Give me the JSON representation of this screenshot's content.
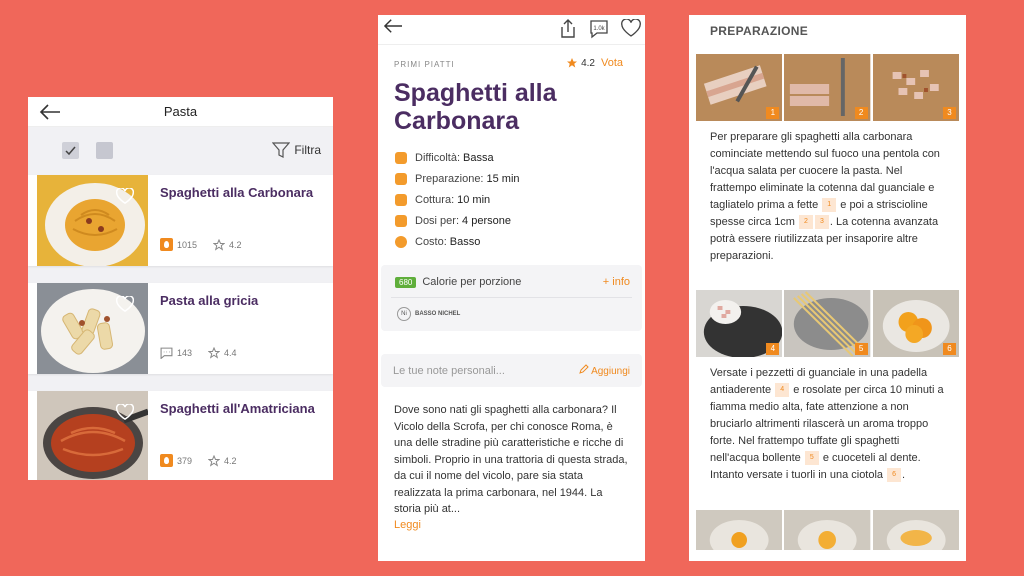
{
  "list": {
    "title": "Pasta",
    "filter_label": "Filtra",
    "recipes": [
      {
        "name": "Spaghetti alla Carbonara",
        "count": "1015",
        "rating": "4.2"
      },
      {
        "name": "Pasta alla gricia",
        "count": "143",
        "rating": "4.4"
      },
      {
        "name": "Spaghetti all'Amatriciana",
        "count": "379",
        "rating": "4.2"
      }
    ]
  },
  "detail": {
    "share_count": "1.0k",
    "category": "PRIMI PIATTI",
    "rating": "4.2",
    "vote_label": "Vota",
    "title": "Spaghetti alla Carbonara",
    "facts": [
      {
        "label": "Difficoltà:",
        "value": "Bassa"
      },
      {
        "label": "Preparazione:",
        "value": "15 min"
      },
      {
        "label": "Cottura:",
        "value": "10 min"
      },
      {
        "label": "Dosi per:",
        "value": "4 persone"
      },
      {
        "label": "Costo:",
        "value": "Basso"
      }
    ],
    "calories_value": "680",
    "calories_label": "Calorie per porzione",
    "more_info": "+ info",
    "nichel_icon_text": "Ni",
    "nichel_label": "BASSO NICHEL",
    "notes_placeholder": "Le tue note personali...",
    "notes_add": "Aggiungi",
    "intro": "Dove sono nati gli spaghetti alla carbonara? Il Vicolo della Scrofa, per chi conosce Roma, è una delle stradine più caratteristiche e ricche di simboli. Proprio in una trattoria di questa strada, da cui il nome del vicolo, pare sia stata realizzata la prima carbonara, nel 1944. La storia più at...",
    "read_more": "Leggi"
  },
  "prep": {
    "title": "PREPARAZIONE",
    "step_numbers": [
      "1",
      "2",
      "3",
      "4",
      "5",
      "6"
    ],
    "para1_a": "Per preparare gli spaghetti alla carbonara cominciate mettendo sul fuoco una pentola con l'acqua salata per cuocere la pasta. Nel frattempo eliminate la cotenna dal guanciale e tagliatelo prima a fette",
    "para1_b": "e poi a striscioline spesse circa 1cm",
    "para1_c": ". La cotenna avanzata potrà essere riutilizzata per insaporire altre preparazioni.",
    "para2_a": "Versate i pezzetti di guanciale in una padella antiaderente",
    "para2_b": "e rosolate per circa 10 minuti a fiamma medio alta, fate attenzione a non bruciarlo altrimenti rilascerà un aroma troppo forte. Nel frattempo tuffate gli spaghetti nell'acqua bollente",
    "para2_c": "e cuoceteli al dente. Intanto versate i tuorli in una ciotola",
    "para2_d": "."
  },
  "colors": {
    "accent": "#f08a1f",
    "title": "#4b2d62",
    "background": "#f0675a",
    "calorie_badge": "#5fae3b"
  }
}
